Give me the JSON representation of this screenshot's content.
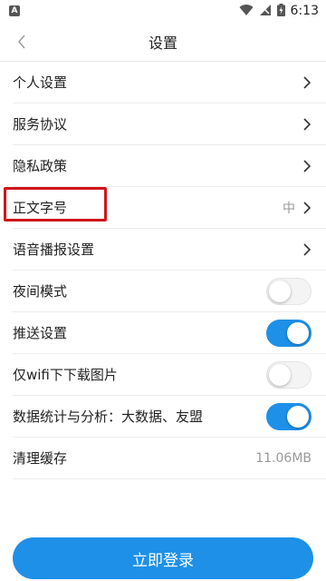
{
  "status_bar": {
    "notification_icon": "A",
    "time": "6:13",
    "icons": [
      "wifi-icon",
      "signal-icon",
      "battery-icon"
    ]
  },
  "header": {
    "title": "设置",
    "back_icon": "chevron-left-icon"
  },
  "settings": {
    "personal": {
      "label": "个人设置"
    },
    "service_agreement": {
      "label": "服务协议"
    },
    "privacy_policy": {
      "label": "隐私政策"
    },
    "font_size": {
      "label": "正文字号",
      "value": "中",
      "highlighted": true
    },
    "voice_broadcast": {
      "label": "语音播报设置"
    },
    "night_mode": {
      "label": "夜间模式",
      "enabled": false
    },
    "push": {
      "label": "推送设置",
      "enabled": true
    },
    "wifi_images": {
      "label": "仅wifi下下载图片",
      "enabled": false
    },
    "analytics": {
      "label": "数据统计与分析：大数据、友盟",
      "enabled": true
    },
    "clear_cache": {
      "label": "清理缓存",
      "value": "11.06MB"
    }
  },
  "login_button": {
    "label": "立即登录"
  },
  "colors": {
    "accent": "#1e90e8",
    "highlight": "#d0161b",
    "divider": "#ececec"
  }
}
